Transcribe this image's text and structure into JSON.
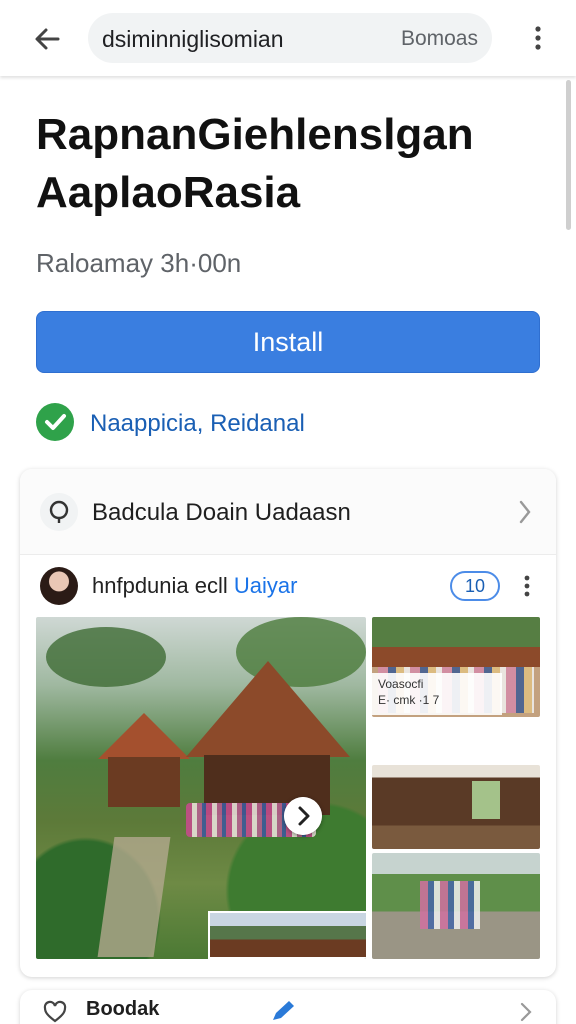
{
  "address_bar": {
    "url": "dsiminniglisomian",
    "right_text": "Bomoas"
  },
  "app": {
    "title": "RapnanGiehlenslgan AaplaoRasia",
    "subtitle": "Raloamay 3h·00n",
    "install_label": "Install",
    "verified_label": "Naappicia, Reidanal"
  },
  "location_card": {
    "title": "Badcula Doain Uadaasn",
    "post": {
      "author": "hnfpdunia ecll",
      "link": "Uaiyar",
      "badge": "10",
      "caption_line1": "Voasocfi",
      "caption_line2": "E· cmk ·1 7"
    }
  },
  "bottom_card": {
    "label": "Boodak"
  },
  "colors": {
    "accent": "#3a7ee0",
    "verified": "#2fa24a",
    "link": "#1a73e8"
  },
  "icons": [
    "back-arrow-icon",
    "more-vert-icon",
    "check-circle-icon",
    "location-pin-icon",
    "chevron-right-icon",
    "play-icon",
    "heart-icon",
    "edit-icon"
  ]
}
